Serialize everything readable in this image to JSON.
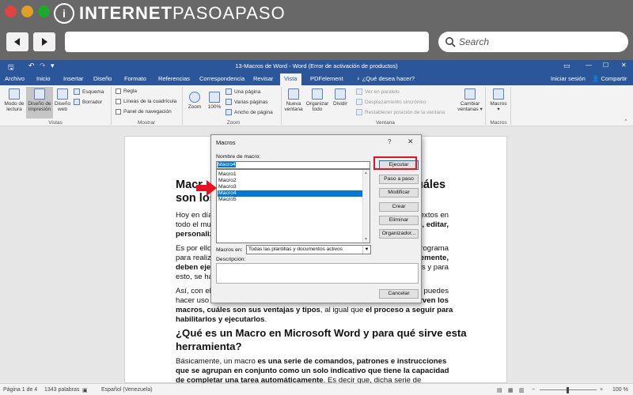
{
  "browser": {
    "brand_pre": "INTERNET",
    "brand_post": "PASOAPASO",
    "brand_logo": "i",
    "search_placeholder": "Search",
    "traffic_lights": [
      "#e0443e",
      "#dea123",
      "#1aab29"
    ]
  },
  "titlebar": {
    "title": "13-Macros de Word - Word (Error de activación de productos)",
    "controls": [
      "—",
      "☐",
      "✕"
    ]
  },
  "tabs": [
    "Archivo",
    "Inicio",
    "Insertar",
    "Diseño",
    "Formato",
    "Referencias",
    "Correspondencia",
    "Revisar",
    "Vista",
    "PDFelement"
  ],
  "tab_active": "Vista",
  "tell_me": "♀ ¿Qué desea hacer?",
  "sign_in": "Iniciar sesión",
  "share": "Compartir",
  "ribbon": {
    "vistas": {
      "modo_lectura": [
        "Modo de",
        "lectura"
      ],
      "diseno_impresion": [
        "Diseño de",
        "impresión"
      ],
      "diseno_web": [
        "Diseño",
        "web"
      ],
      "esquema": "Esquema",
      "borrador": "Borrador",
      "label": "Vistas"
    },
    "mostrar": {
      "regla": "Regla",
      "lineas": "Líneas de la cuadrícula",
      "panel": "Panel de navegación",
      "label": "Mostrar"
    },
    "zoom": {
      "zoom": "Zoom",
      "cien": "100%",
      "una_pagina": "Una página",
      "varias_paginas": "Varias páginas",
      "ancho": "Ancho de página",
      "label": "Zoom"
    },
    "ventana": {
      "nueva": [
        "Nueva",
        "ventana"
      ],
      "organizar": [
        "Organizar",
        "todo"
      ],
      "dividir": "Dividir",
      "paralelo": "Ver en paralelo",
      "sincronico": "Desplazamiento sincrónico",
      "restablecer": "Restablecer posición de la ventana",
      "cambiar": [
        "Cambiar",
        "ventanas ▾"
      ],
      "label": "Ventana"
    },
    "macros": {
      "macros": [
        "Macros",
        "▾"
      ],
      "label": "Macros"
    }
  },
  "document": {
    "h1_l1_a": "Macr",
    "h1_l1_b": "uáles",
    "h1_l2": "son los",
    "p1": [
      {
        "a": "Hoy en día",
        "b": "extos en"
      },
      {
        "a": "todo el mu",
        "b": ", editar,"
      },
      {
        "a": "personaliz",
        "b": ""
      }
    ],
    "p2": [
      {
        "a": "Es por ello",
        "b": "rograma"
      },
      {
        "a": "para realiz",
        "b": "emente,"
      },
      {
        "a": "deben ejec",
        "b": "s y para"
      },
      {
        "a": "esto, se ha",
        "b": ""
      }
    ],
    "p3_l1_a": "Así, con el",
    "p3_l1_b": "puedes",
    "p3_l2_a": "hacer uso c",
    "p3_l2_b": "rven los",
    "p3_l3_bold1": "macros, cuáles son sus ventajas y tipos",
    "p3_l3_rest": ", al igual que",
    "p3_l3_bold2": " el proceso a seguir para",
    "p3_l4": "habilitarlos y ejecutarlos",
    "p3_l4_end": ".",
    "h2_l1": "¿Qué es un Macro en Microsoft Word y para qué sirve esta",
    "h2_l2": "herramienta?",
    "p4_l1_a": "Básicamente, un macro ",
    "p4_l1_b": "es una serie de comandos, patrones e instrucciones",
    "p4_l2": "que se agrupan en conjunto como un solo indicativo que tiene la capacidad",
    "p4_l3_a": "de completar una tarea automáticamente",
    "p4_l3_b": ". Es decir que, dicha serie de"
  },
  "statusbar": {
    "page": "Página 1 de 4",
    "words": "1343 palabras",
    "lang": "Español (Venezuela)",
    "zoom": "100 %"
  },
  "dialog": {
    "title": "Macros",
    "help": "?",
    "close": "✕",
    "name_label": "Nombre de macro:",
    "name_value": "Macro4",
    "list": [
      "Macro1",
      "Macro2",
      "Macro3",
      "Macro4",
      "Macro5"
    ],
    "selected": "Macro4",
    "macros_in_label": "Macros en:",
    "macros_in_value": "Todas las plantillas y documentos activos",
    "desc_label": "Descripción:",
    "buttons": {
      "run": "Ejecutar",
      "step": "Paso a paso",
      "modify": "Modificar",
      "create": "Crear",
      "delete": "Eliminar",
      "organizer": "Organizador...",
      "cancel": "Cancelar"
    }
  },
  "colors": {
    "word_blue": "#2b579a",
    "highlight": "#e81123",
    "arrow": "#e81123",
    "selection": "#0078d7"
  }
}
